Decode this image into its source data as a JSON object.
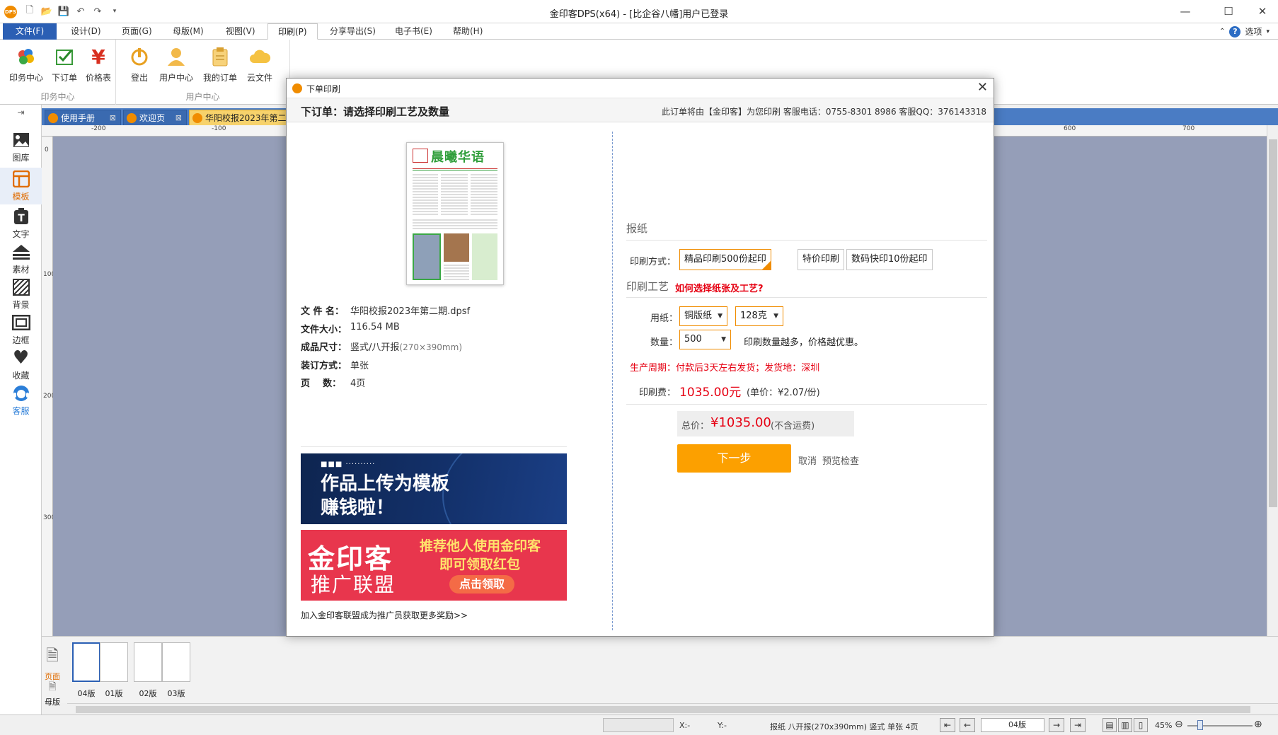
{
  "app": {
    "window_title": "金印客DPS(x64) - [比企谷八幡]用户已登录",
    "logo_text": "DPS"
  },
  "menu": {
    "tabs": [
      "文件(F)",
      "设计(D)",
      "页面(G)",
      "母版(M)",
      "视图(V)",
      "印刷(P)",
      "分享导出(S)",
      "电子书(E)",
      "帮助(H)"
    ],
    "active": "印刷(P)",
    "options_label": "选项"
  },
  "ribbon": {
    "group1": {
      "label": "印务中心",
      "buttons": [
        "印务中心",
        "下订单",
        "价格表"
      ]
    },
    "group2": {
      "label": "用户中心",
      "buttons": [
        "登出",
        "用户中心",
        "我的订单",
        "云文件"
      ]
    }
  },
  "sidebar": {
    "items": [
      "图库",
      "模板",
      "文字",
      "素材",
      "背景",
      "边框",
      "收藏",
      "客服"
    ],
    "active": "模板"
  },
  "doc_tabs": [
    "使用手册",
    "欢迎页",
    "华阳校报2023年第二"
  ],
  "ruler": {
    "h_ticks": [
      "-200",
      "-100",
      "600",
      "700"
    ],
    "v_ticks": [
      "0",
      "100",
      "200",
      "300"
    ]
  },
  "pages": {
    "side_labels": [
      "页面",
      "母版"
    ],
    "thumbs": [
      "04版",
      "01版",
      "02版",
      "03版"
    ],
    "selected": "04版"
  },
  "status": {
    "x_label": "X:-",
    "y_label": "Y:-",
    "doc_info": "报纸 八开报(270x390mm) 竖式 单张 4页",
    "page_select": "04版",
    "zoom": "45%"
  },
  "dialog": {
    "title": "下单印刷",
    "heading": "下订单：请选择印刷工艺及数量",
    "contact": "此订单将由【金印客】为您印刷 客服电话：0755-8301 8986 客服QQ：376143318",
    "preview": {
      "newspaper_title": "晨曦华语"
    },
    "file_info": [
      {
        "key": "文 件 名：",
        "value": "华阳校报2023年第二期.dpsf"
      },
      {
        "key": "文件大小：",
        "value": "116.54 MB"
      },
      {
        "key": "成品尺寸：",
        "value": "竖式/八开报",
        "extra": "(270×390mm)"
      },
      {
        "key": "装订方式：",
        "value": "单张"
      },
      {
        "key": "页    数：",
        "value": "4页"
      }
    ],
    "ad1": {
      "dots": "■■■ ··········",
      "line1": "作品上传为模板",
      "line2": "赚钱啦！"
    },
    "ad2": {
      "brand": "金印客",
      "sub": "推广联盟",
      "promo1": "推荐他人使用金印客",
      "promo2": "即可领取红包",
      "cta": "点击领取"
    },
    "ad_link": "加入金印客联盟成为推广员获取更多奖励>>",
    "product_section": "报纸",
    "print_method_label": "印刷方式：",
    "print_methods": [
      "精品印刷500份起印",
      "特价印刷",
      "数码快印10份起印"
    ],
    "print_method_selected": "精品印刷500份起印",
    "craft_section": "印刷工艺",
    "howto_link": "如何选择纸张及工艺?",
    "paper_label": "用纸：",
    "paper_type": "铜版纸",
    "paper_weight": "128克",
    "qty_label": "数量：",
    "qty": "500",
    "qty_tip": "印刷数量越多，价格越优惠。",
    "cycle_label": "生产周期：",
    "cycle_text": "付款后3天左右发货；发货地：深圳",
    "fee_label": "印刷费：",
    "fee": "1035.00元",
    "unit_price": "(单价：¥2.07/份)",
    "total_label": "总价：",
    "total": "¥1035.00",
    "total_note": "(不含运费)",
    "next_button": "下一步",
    "cancel_link": "取消",
    "preview_link": "预览检查"
  }
}
